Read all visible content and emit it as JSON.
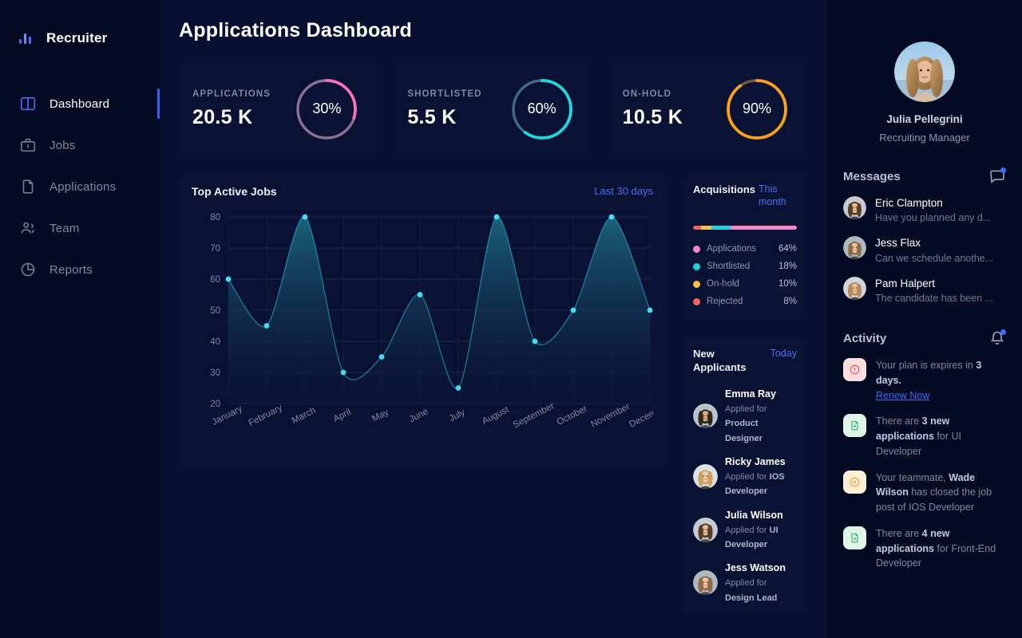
{
  "sidebar": {
    "brand": {
      "name": "Recruiter",
      "icon": "bar-chart-icon"
    },
    "items": [
      {
        "label": "Dashboard",
        "icon": "layout-columns-icon",
        "active": true
      },
      {
        "label": "Jobs",
        "icon": "briefcase-icon",
        "active": false
      },
      {
        "label": "Applications",
        "icon": "document-icon",
        "active": false
      },
      {
        "label": "Team",
        "icon": "users-icon",
        "active": false
      },
      {
        "label": "Reports",
        "icon": "pie-chart-icon",
        "active": false
      }
    ]
  },
  "header": {
    "title": "Applications Dashboard"
  },
  "stats": [
    {
      "label": "APPLICATIONS",
      "value": "20.5 K",
      "percent_label": "30%",
      "percent": 30,
      "color": "#f472b6",
      "track": "#8f6f92"
    },
    {
      "label": "SHORTLISTED",
      "value": "5.5 K",
      "percent_label": "60%",
      "percent": 60,
      "color": "#1fd6e3",
      "track": "#3c6d82"
    },
    {
      "label": "ON-HOLD",
      "value": "10.5 K",
      "percent_label": "90%",
      "percent": 90,
      "color": "#f9a11b",
      "track": "#6b5c44"
    }
  ],
  "chart_card": {
    "title": "Top Active Jobs",
    "range_label": "Last 30 days"
  },
  "chart_data": {
    "type": "area",
    "title": "Top Active Jobs",
    "xlabel": "",
    "ylabel": "",
    "categories": [
      "January",
      "February",
      "March",
      "April",
      "May",
      "June",
      "July",
      "August",
      "September",
      "October",
      "November",
      "December"
    ],
    "values": [
      60,
      45,
      80,
      30,
      35,
      55,
      25,
      80,
      40,
      50,
      80,
      50
    ],
    "yticks": [
      20,
      30,
      40,
      50,
      60,
      70,
      80
    ],
    "ylim": [
      20,
      80
    ],
    "grid": true,
    "legend": "none",
    "line_color": "#2ad2ef",
    "marker_color": "#3fe0f5",
    "fill_top": "#1c6a82",
    "fill_bottom": "#0a1233"
  },
  "acquisitions": {
    "title": "Acquisitions",
    "action": "This month",
    "segments": [
      {
        "name": "Rejected",
        "percent": 8,
        "color": "#f2645a"
      },
      {
        "name": "On-hold",
        "percent": 10,
        "color": "#fbbf45"
      },
      {
        "name": "Shortlisted",
        "percent": 18,
        "color": "#19d3dd"
      },
      {
        "name": "Applications",
        "percent": 64,
        "color": "#f986c8"
      }
    ],
    "legend": [
      {
        "name": "Applications",
        "value": "64%",
        "color": "#f986c8"
      },
      {
        "name": "Shortlisted",
        "value": "18%",
        "color": "#19d3dd"
      },
      {
        "name": "On-hold",
        "value": "10%",
        "color": "#fbbf45"
      },
      {
        "name": "Rejected",
        "value": "8%",
        "color": "#f2645a"
      }
    ]
  },
  "new_applicants": {
    "title": "New Applicants",
    "action": "Today",
    "items": [
      {
        "name": "Emma Ray",
        "applied_prefix": "Applied for ",
        "role": "Product Designer"
      },
      {
        "name": "Ricky James",
        "applied_prefix": "Applied for ",
        "role": "IOS Developer"
      },
      {
        "name": "Julia Wilson",
        "applied_prefix": "Applied for ",
        "role": "UI Developer"
      },
      {
        "name": "Jess Watson",
        "applied_prefix": "Applied for ",
        "role": "Design Lead"
      }
    ]
  },
  "profile": {
    "name": "Julia Pellegrini",
    "role": "Recruiting Manager"
  },
  "messages": {
    "title": "Messages",
    "icon": "message-icon",
    "items": [
      {
        "name": "Eric Clampton",
        "preview": "Have you planned any d..."
      },
      {
        "name": "Jess Flax",
        "preview": "Can we schedule anothe..."
      },
      {
        "name": "Pam Halpert",
        "preview": "The candidate has been ..."
      }
    ]
  },
  "activity": {
    "title": "Activity",
    "icon": "bell-icon",
    "items": [
      {
        "icon": "alert-circle-icon",
        "icon_bg": "#fbdfe0",
        "icon_color": "#ef4a5a",
        "text_parts": [
          {
            "t": "Your plan is expires in ",
            "b": false
          },
          {
            "t": "3 days.",
            "b": true
          }
        ],
        "link": "Renew Now"
      },
      {
        "icon": "file-plus-icon",
        "icon_bg": "#dff3e6",
        "icon_color": "#2bb673",
        "text_parts": [
          {
            "t": "There are ",
            "b": false
          },
          {
            "t": "3 new applications",
            "b": true
          },
          {
            "t": " for UI Developer",
            "b": false
          }
        ],
        "link": ""
      },
      {
        "icon": "close-circle-icon",
        "icon_bg": "#fdeed6",
        "icon_color": "#f0a63c",
        "text_parts": [
          {
            "t": "Your teammate, ",
            "b": false
          },
          {
            "t": "Wade Wilson",
            "b": true
          },
          {
            "t": " has closed the job post of IOS Developer",
            "b": false
          }
        ],
        "link": ""
      },
      {
        "icon": "file-plus-icon",
        "icon_bg": "#dff3e6",
        "icon_color": "#2bb673",
        "text_parts": [
          {
            "t": "There are ",
            "b": false
          },
          {
            "t": "4 new applications",
            "b": true
          },
          {
            "t": " for Front-End Developer",
            "b": false
          }
        ],
        "link": ""
      }
    ]
  },
  "theme": {
    "bg_main": "#071031",
    "bg_rail": "#040a22",
    "card": "#0a1233",
    "accent": "#3b5bfd",
    "text_muted": "#7e88a4"
  }
}
